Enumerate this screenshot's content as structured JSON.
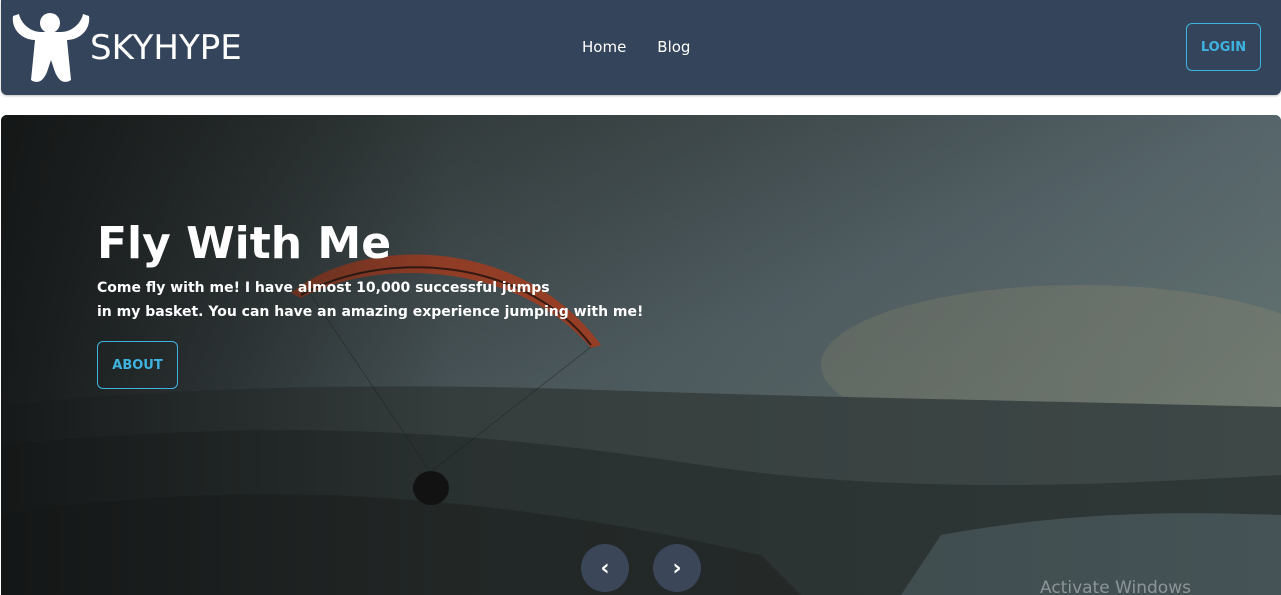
{
  "navbar": {
    "brand": "SKYHYPE",
    "logo_icon": "person-arms-raised-icon",
    "links": [
      "Home",
      "Blog"
    ],
    "login_label": "LOGIN",
    "accent_color": "#3fb3e0",
    "background_color": "#34445a"
  },
  "hero": {
    "title": "Fly With Me",
    "text_line1": "Come fly with me! I have almost 10,000 successful jumps",
    "text_line2": "in my basket. You can have an amazing experience jumping with me!",
    "about_label": "ABOUT",
    "prev_icon": "chevron-left-icon",
    "next_icon": "chevron-right-icon",
    "prev_glyph": "‹",
    "next_glyph": "›"
  },
  "os_watermark": "Activate Windows"
}
